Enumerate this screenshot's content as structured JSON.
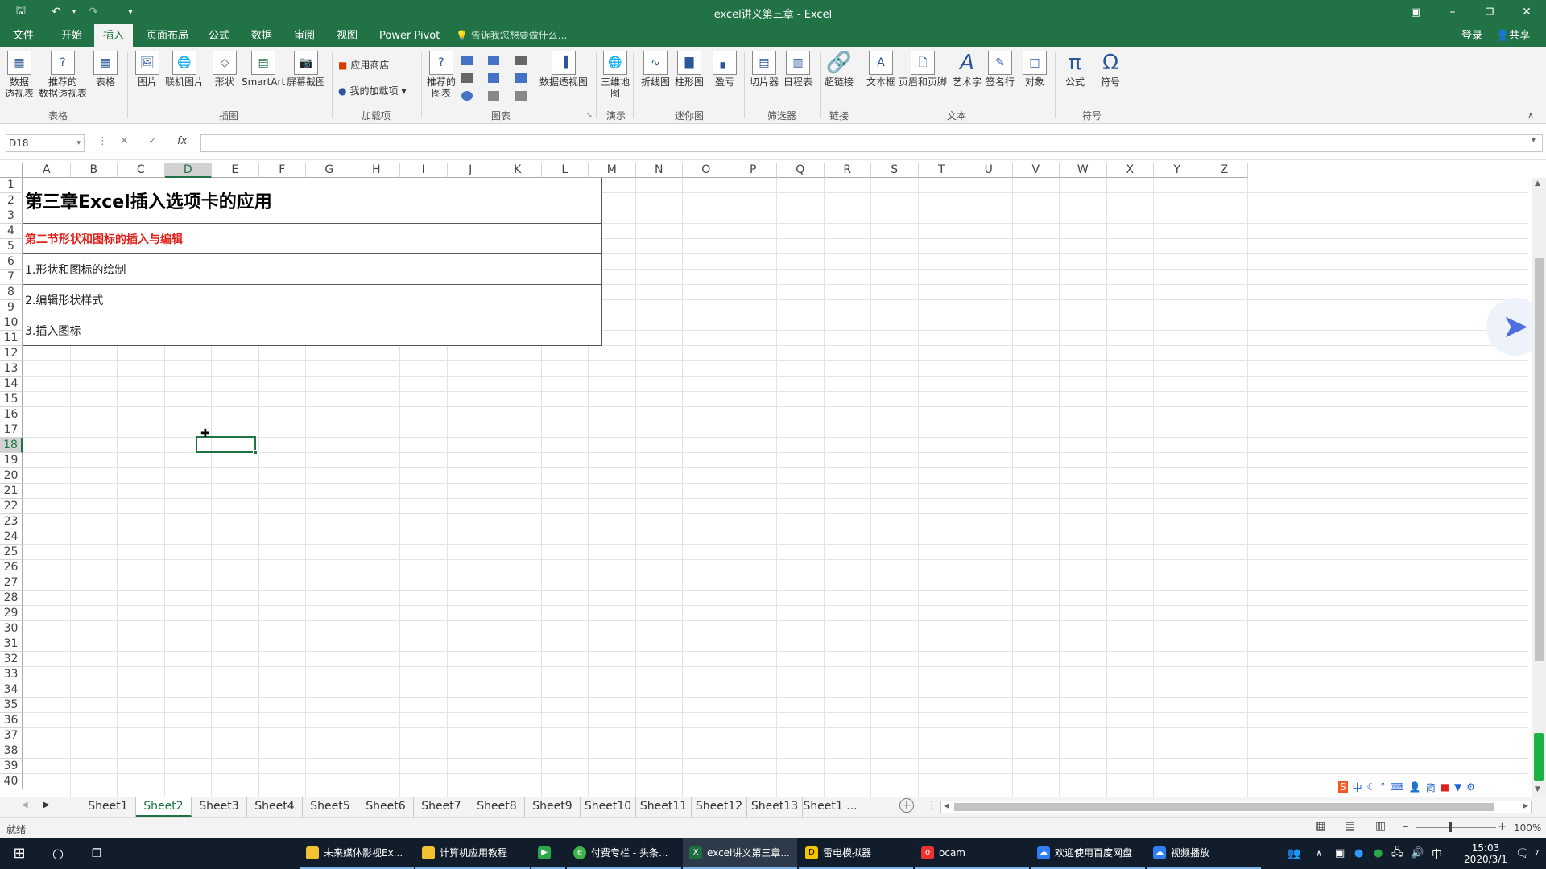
{
  "window": {
    "title": "excel讲义第三章 - Excel"
  },
  "menu": {
    "tabs": [
      "文件",
      "开始",
      "插入",
      "页面布局",
      "公式",
      "数据",
      "审阅",
      "视图",
      "Power Pivot"
    ],
    "active": "插入",
    "tell_me": "告诉我您想要做什么...",
    "login": "登录",
    "share": "共享"
  },
  "ribbon": {
    "tables": {
      "pivot": "数据\n透视表",
      "rec_pivot": "推荐的\n数据透视表",
      "table": "表格",
      "group": "表格"
    },
    "illustrations": {
      "picture": "图片",
      "online_picture": "联机图片",
      "shapes": "形状",
      "smartart": "SmartArt",
      "screenshot": "屏幕截图",
      "group": "插图"
    },
    "addins": {
      "store": "应用商店",
      "my_addins": "我的加载项",
      "group": "加载项"
    },
    "charts": {
      "recommended": "推荐的\n图表",
      "pivot_chart": "数据透视图",
      "group": "图表"
    },
    "tours": {
      "map3d": "三维地\n图",
      "group": "演示"
    },
    "sparklines": {
      "line": "折线图",
      "column": "柱形图",
      "winloss": "盈亏",
      "group": "迷你图"
    },
    "filters": {
      "slicer": "切片器",
      "timeline": "日程表",
      "group": "筛选器"
    },
    "links": {
      "hyperlink": "超链接",
      "group": "链接"
    },
    "text": {
      "textbox": "文本框",
      "header_footer": "页眉和页脚",
      "wordart": "艺术字",
      "signature": "签名行",
      "object": "对象",
      "group": "文本"
    },
    "symbols": {
      "equation": "公式",
      "symbol": "符号",
      "group": "符号"
    }
  },
  "formula_bar": {
    "name_box": "D18",
    "fx": "fx",
    "value": ""
  },
  "columns": [
    "A",
    "B",
    "C",
    "D",
    "E",
    "F",
    "G",
    "H",
    "I",
    "J",
    "K",
    "L",
    "M",
    "N",
    "O",
    "P",
    "Q",
    "R",
    "S",
    "T",
    "U",
    "V",
    "W",
    "X",
    "Y",
    "Z"
  ],
  "selected_column": "D",
  "selected_row": "18",
  "rows": [
    "1",
    "2",
    "3",
    "4",
    "5",
    "6",
    "7",
    "8",
    "9",
    "10",
    "11",
    "12",
    "13",
    "14",
    "15",
    "16",
    "17",
    "18",
    "19",
    "20",
    "21",
    "22",
    "23",
    "24",
    "25",
    "26",
    "27",
    "28",
    "29",
    "30",
    "31",
    "32",
    "33",
    "34",
    "35",
    "36",
    "37",
    "38",
    "39",
    "40"
  ],
  "sheet_content": {
    "title": "第三章Excel插入选项卡的应用",
    "section": "第二节形状和图标的插入与编辑",
    "item1": "1.形状和图标的绘制",
    "item2": "2.编辑形状样式",
    "item3": "3.插入图标"
  },
  "section_color": "#e0201b",
  "sheets": [
    "Sheet1",
    "Sheet2",
    "Sheet3",
    "Sheet4",
    "Sheet5",
    "Sheet6",
    "Sheet7",
    "Sheet8",
    "Sheet9",
    "Sheet10",
    "Sheet11",
    "Sheet12",
    "Sheet13",
    "Sheet1 ..."
  ],
  "active_sheet": "Sheet2",
  "status": {
    "ready": "就绪",
    "zoom": "100%"
  },
  "taskbar": {
    "apps": [
      "未来媒体影视Ex...",
      "计算机应用教程",
      "",
      "付费专栏 - 头条...",
      "excel讲义第三章...",
      "雷电模拟器",
      "ocam",
      "欢迎使用百度网盘",
      "视频播放"
    ],
    "ime": "中",
    "time": "15:03",
    "date": "2020/3/1",
    "notifications": "7"
  },
  "ime_toolbar": [
    "中",
    "简"
  ]
}
